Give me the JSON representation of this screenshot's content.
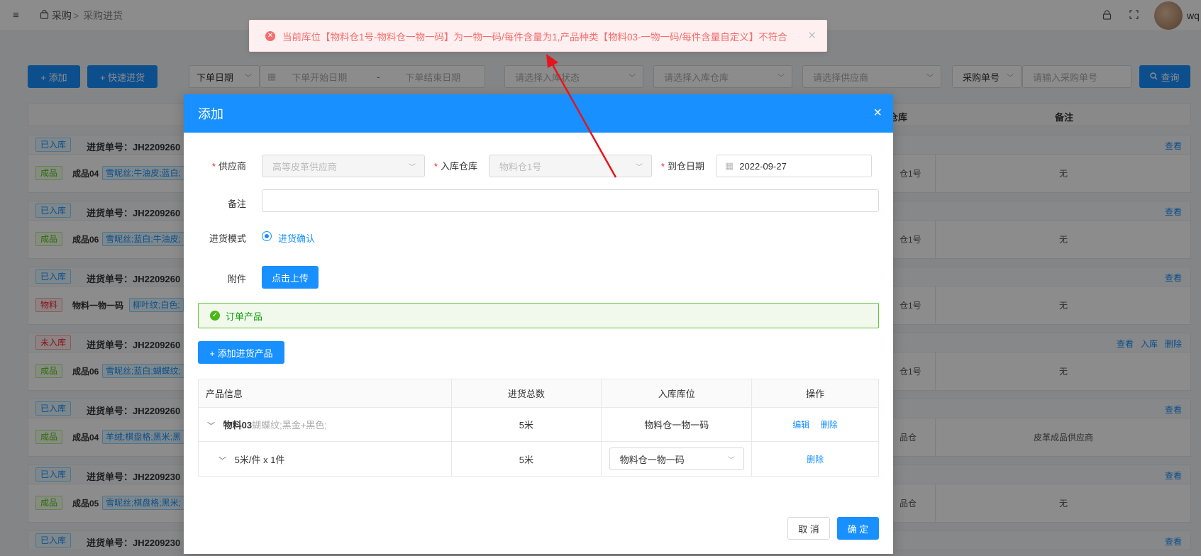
{
  "header": {
    "toggle_icon": "≡",
    "breadcrumb": {
      "root": "采购",
      "sep": ">",
      "current": "采购进货"
    },
    "user": "wq"
  },
  "toolbar": {
    "add": "+ 添加",
    "quick": "+ 快速进货",
    "date_type": "下单日期",
    "start_date_placeholder": "下单开始日期",
    "date_sep": "-",
    "end_date_placeholder": "下单结束日期",
    "status_placeholder": "请选择入库状态",
    "warehouse_placeholder": "请选择入库仓库",
    "supplier_placeholder": "请选择供应商",
    "no_type": "采购单号",
    "no_placeholder": "请输入采购单号",
    "search": "查询"
  },
  "list": {
    "col_warehouse": "库仓库",
    "col_remark": "备注",
    "groups": [
      {
        "status": "已入库",
        "status_color": "blue",
        "no": "进货单号：JH2209260",
        "actions": [
          "查看"
        ],
        "type": "成品",
        "type_color": "green",
        "name": "成品04",
        "attr": "雪昵丝;牛油皮;蓝白;",
        "wh": "仓1号",
        "remark": "无"
      },
      {
        "status": "已入库",
        "status_color": "blue",
        "no": "进货单号：JH2209260",
        "actions": [
          "查看"
        ],
        "type": "成品",
        "type_color": "green",
        "name": "成品06",
        "attr": "雪昵丝;蓝白;牛油皮;",
        "wh": "仓1号",
        "remark": "无"
      },
      {
        "status": "已入库",
        "status_color": "blue",
        "no": "进货单号：JH2209260",
        "actions": [
          "查看"
        ],
        "type": "物料",
        "type_color": "red",
        "name": "物料一物一码",
        "attr": "柳叶纹;白色;",
        "wh": "仓1号",
        "remark": "无"
      },
      {
        "status": "未入库",
        "status_color": "red",
        "no": "进货单号：JH2209260",
        "actions": [
          "查看",
          "入库",
          "删除"
        ],
        "type": "成品",
        "type_color": "green",
        "name": "成品06",
        "attr": "雪昵丝;蓝白;蝴蝶纹;",
        "wh": "仓1号",
        "remark": "无"
      },
      {
        "status": "已入库",
        "status_color": "blue",
        "no": "进货单号：JH2209260",
        "actions": [
          "查看"
        ],
        "type": "成品",
        "type_color": "green",
        "name": "成品04",
        "attr": "羊绒;棋盘格;黑米;黑",
        "wh": "品仓",
        "remark": "皮革成品供应商"
      },
      {
        "status": "已入库",
        "status_color": "blue",
        "no": "进货单号：JH2209230",
        "actions": [
          "查看"
        ],
        "type": "成品",
        "type_color": "green",
        "name": "成品05",
        "attr": "雪昵丝;棋盘格;黑米;",
        "wh": "品仓",
        "remark": "无"
      },
      {
        "status": "已入库",
        "status_color": "blue",
        "no": "进货单号：JH2209230",
        "actions": [
          "查看"
        ]
      }
    ]
  },
  "modal": {
    "title": "添加",
    "close_icon": "×",
    "supplier_label": "供应商",
    "supplier_value": "高等皮革供应商",
    "warehouse_label": "入库仓库",
    "warehouse_value": "物料仓1号",
    "date_label": "到仓日期",
    "date_value": "2022-09-27",
    "remark_label": "备注",
    "mode_label": "进货模式",
    "mode_value": "进货确认",
    "attach_label": "附件",
    "upload": "点击上传",
    "order_products": "订单产品",
    "add_product": "+ 添加进货产品",
    "table": {
      "headers": [
        "产品信息",
        "进货总数",
        "入库库位",
        "操作"
      ],
      "product": {
        "name": "物料03",
        "spec": "蝴蝶纹;黑金+黑色;",
        "total": "5米",
        "location": "物料仓一物一码",
        "edit": "编辑",
        "delete": "删除"
      },
      "sub": {
        "pack": "5米/件 x 1件",
        "total": "5米",
        "location": "物料仓一物一码",
        "delete": "删除"
      }
    },
    "cancel": "取 消",
    "ok": "确 定"
  },
  "toast": {
    "message": "当前库位【物料仓1号-物料仓一物一码】为一物一码/每件含量为1,产品种类【物料03-一物一码/每件含量自定义】不符合",
    "color": "#f56c6c"
  },
  "annotation": {
    "arrow_color": "#e8141b"
  }
}
